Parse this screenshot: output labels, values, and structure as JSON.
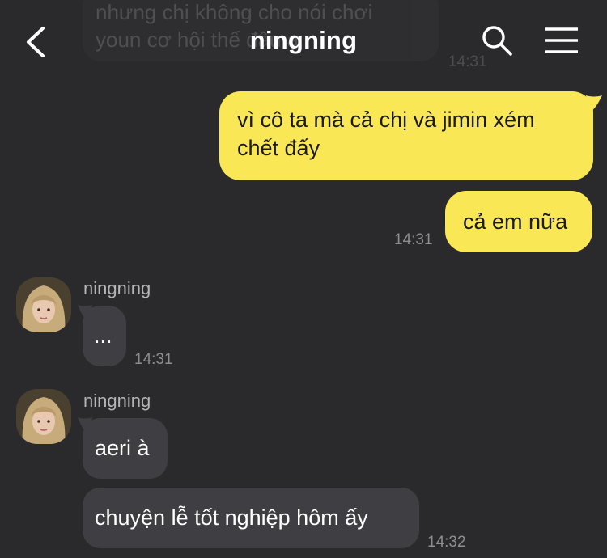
{
  "header": {
    "title": "ningning"
  },
  "previous_message": {
    "text_line1": "nhưng chị không cho nói chơi",
    "text_line2": "youn cơ hội thế đâu ạ",
    "time": "14:31"
  },
  "messages_me": [
    {
      "text_line1": "vì cô ta mà cả chị và jimin xém",
      "text_line2": "chết đấy"
    },
    {
      "text": "cả em nữa",
      "time": "14:31"
    }
  ],
  "messages_other": [
    {
      "sender": "ningning",
      "text": "...",
      "time": "14:31"
    },
    {
      "sender": "ningning",
      "text": "aeri à"
    },
    {
      "text": "chuyện lễ tốt nghiệp hôm ấy",
      "time": "14:32"
    }
  ],
  "colors": {
    "background": "#2a2a2c",
    "my_bubble": "#fae755",
    "other_bubble": "#3f3f43"
  },
  "icons": [
    "back-arrow-icon",
    "search-icon",
    "menu-icon",
    "avatar"
  ]
}
